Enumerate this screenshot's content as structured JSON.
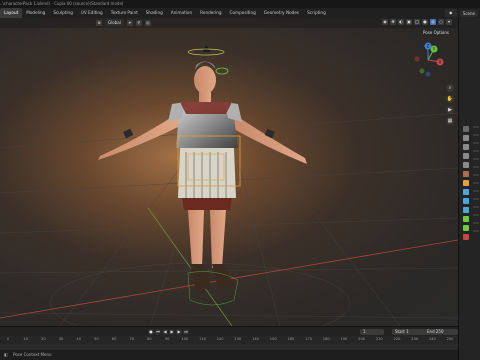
{
  "window": {
    "title": "..\\characterPack 1.blend) - Cupla 00 (source)(Standard mode)"
  },
  "workspace_tabs": [
    {
      "label": "Layout",
      "active": true
    },
    {
      "label": "Modeling",
      "active": false
    },
    {
      "label": "Sculpting",
      "active": false
    },
    {
      "label": "UV Editing",
      "active": false
    },
    {
      "label": "Texture Paint",
      "active": false
    },
    {
      "label": "Shading",
      "active": false
    },
    {
      "label": "Animation",
      "active": false
    },
    {
      "label": "Rendering",
      "active": false
    },
    {
      "label": "Compositing",
      "active": false
    },
    {
      "label": "Geometry Nodes",
      "active": false
    },
    {
      "label": "Scripting",
      "active": false
    }
  ],
  "scene": {
    "label": "Scene"
  },
  "viewport": {
    "transform_orientation": "Global",
    "pose_options": "Pose Options",
    "gizmo": {
      "x": "X",
      "y": "Y",
      "z": "Z"
    }
  },
  "playback": {
    "current_frame": "1",
    "start_label": "Start",
    "start": "1",
    "end_label": "End",
    "end": "250"
  },
  "timeline": {
    "ticks": [
      "0",
      "10",
      "20",
      "30",
      "40",
      "50",
      "60",
      "70",
      "80",
      "90",
      "100",
      "110",
      "120",
      "130",
      "140",
      "150",
      "160",
      "170",
      "180",
      "190",
      "200",
      "210",
      "220",
      "230",
      "240",
      "250"
    ]
  },
  "status": {
    "context_menu": "Pose Context Menu"
  },
  "colors": {
    "accent": "#4772b3",
    "bone_active": "#e0a33a",
    "bone_select": "#6ccf3a"
  },
  "icons": [
    "move-icon",
    "cursor-icon",
    "zoom-icon",
    "hand-icon",
    "camera-icon",
    "grid-icon",
    "play-icon",
    "rewind-icon",
    "forward-icon"
  ]
}
